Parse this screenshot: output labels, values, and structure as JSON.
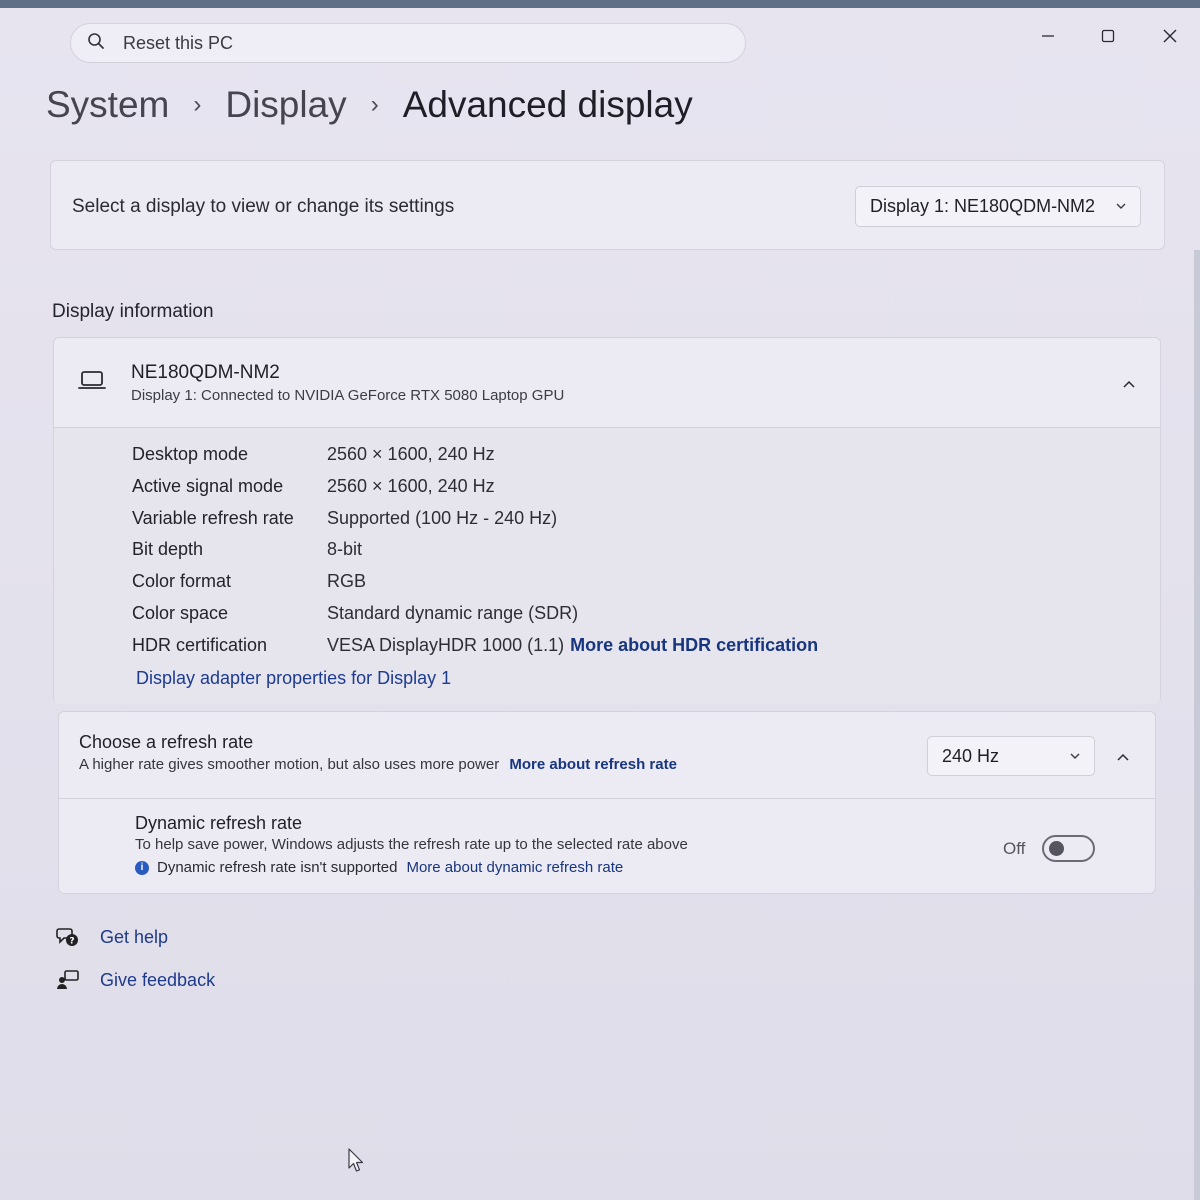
{
  "search": {
    "placeholder": "Reset this PC"
  },
  "breadcrumb": {
    "items": [
      "System",
      "Display",
      "Advanced display"
    ]
  },
  "select_display": {
    "label": "Select a display to view or change its settings",
    "selected": "Display 1: NE180QDM-NM2"
  },
  "display_information": {
    "section_title": "Display information",
    "device_name": "NE180QDM-NM2",
    "device_subtitle": "Display 1: Connected to NVIDIA GeForce RTX 5080 Laptop GPU",
    "rows": [
      {
        "label": "Desktop mode",
        "value": "2560 × 1600, 240 Hz"
      },
      {
        "label": "Active signal mode",
        "value": "2560 × 1600, 240 Hz"
      },
      {
        "label": "Variable refresh rate",
        "value": "Supported (100 Hz - 240 Hz)"
      },
      {
        "label": "Bit depth",
        "value": "8-bit"
      },
      {
        "label": "Color format",
        "value": "RGB"
      },
      {
        "label": "Color space",
        "value": "Standard dynamic range (SDR)"
      },
      {
        "label": "HDR certification",
        "value": "VESA DisplayHDR 1000 (1.1)",
        "link": "More about HDR certification"
      }
    ],
    "adapter_link": "Display adapter properties for Display 1"
  },
  "refresh_rate": {
    "title": "Choose a refresh rate",
    "subtitle": "A higher rate gives smoother motion, but also uses more power",
    "link": "More about refresh rate",
    "selected": "240 Hz"
  },
  "dynamic_refresh": {
    "title": "Dynamic refresh rate",
    "subtitle": "To help save power, Windows adjusts the refresh rate up to the selected rate above",
    "note": "Dynamic refresh rate isn't supported",
    "note_link": "More about dynamic refresh rate",
    "toggle_label": "Off",
    "toggle_on": false
  },
  "footer_links": {
    "get_help": "Get help",
    "give_feedback": "Give feedback"
  },
  "icons": {
    "search": "search-icon",
    "minimize": "minimize-icon",
    "maximize": "maximize-icon",
    "close": "close-icon",
    "laptop": "laptop-icon",
    "help": "help-icon",
    "feedback": "feedback-icon",
    "info": "info-icon"
  },
  "colors": {
    "link": "#1d3b8f",
    "accent": "#2a5bc0"
  }
}
